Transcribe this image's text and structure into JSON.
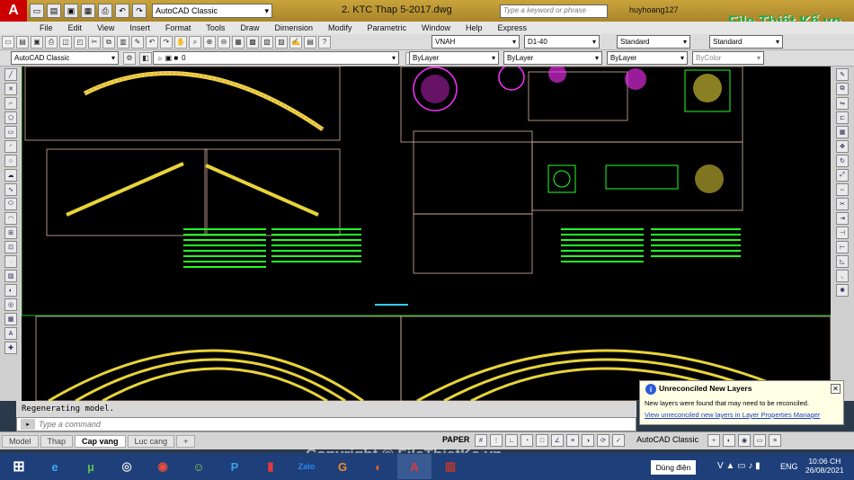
{
  "titlebar": {
    "logo": "A",
    "workspace": "AutoCAD Classic",
    "doc_title": "2. KTC Thap 5-2017.dwg",
    "search_placeholder": "Type a keyword or phrase",
    "user": "huyhoang127"
  },
  "menu": [
    "File",
    "Edit",
    "View",
    "Insert",
    "Format",
    "Tools",
    "Draw",
    "Dimension",
    "Modify",
    "Parametric",
    "Window",
    "Help",
    "Express"
  ],
  "toolbar1": {
    "text_style": "VNAH",
    "dim_style": "D1-40",
    "table_style": "Standard",
    "multileader_style": "Standard"
  },
  "toolbar2": {
    "workspace": "AutoCAD Classic",
    "layer": "0",
    "color": "ByLayer",
    "linetype": "ByLayer",
    "lineweight": "ByLayer",
    "plotstyle": "ByColor"
  },
  "command": {
    "history": "Regenerating model.",
    "placeholder": "Type a command"
  },
  "layout_tabs": [
    "Model",
    "Thap",
    "Cap vang",
    "Luc cang"
  ],
  "active_tab": "Cap vang",
  "status": {
    "space": "PAPER",
    "workspace": "AutoCAD Classic"
  },
  "notification": {
    "title": "Unreconciled New Layers",
    "message": "New layers were found that may need to be reconciled.",
    "link": "View unreconciled new layers in Layer Properties Manager"
  },
  "taskbar": {
    "power_label": "Dùng điện",
    "language": "ENG",
    "time": "10:06 CH",
    "date": "26/08/2021"
  },
  "watermark": {
    "logo": "File Thiết Kế.vn",
    "copyright": "Copyright © FileThietKe.vn"
  },
  "colors": {
    "canvas": "#000000",
    "drawing_green": "#22ff22",
    "drawing_yellow": "#e8d43a",
    "drawing_magenta": "#ff30ff"
  }
}
